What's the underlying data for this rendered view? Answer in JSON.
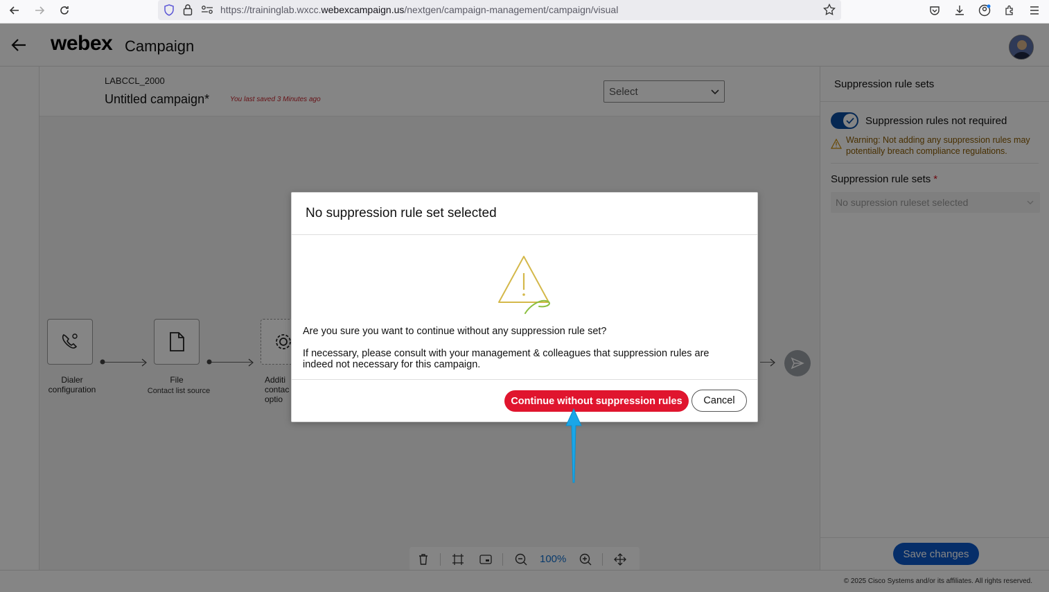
{
  "browser": {
    "url_prefix": "https://traininglab.wxcc.",
    "url_domain": "webexcampaign.us",
    "url_path": "/nextgen/campaign-management/campaign/visual"
  },
  "header": {
    "brand": "webex",
    "product": "Campaign"
  },
  "campaign": {
    "id": "LABCCL_2000",
    "name": "Untitled campaign*",
    "saved_note": "You last saved 3 Minutes ago",
    "select_placeholder": "Select"
  },
  "flow": {
    "nodes": [
      {
        "label": "Dialer",
        "label2": "configuration",
        "sub": ""
      },
      {
        "label": "File",
        "label2": "",
        "sub": "Contact list source"
      },
      {
        "label": "Additi",
        "label2": "contac",
        "label3": "optio"
      }
    ]
  },
  "toolbar": {
    "zoom": "100%"
  },
  "right_panel": {
    "title": "Suppression rule sets",
    "toggle_label": "Suppression rules not required",
    "toggle_on": true,
    "warning": "Warning: Not adding any suppression rules may potentially breach compliance regulations.",
    "field_label": "Suppression rule sets",
    "required_mark": "*",
    "field_placeholder": "No supression ruleset selected",
    "save_label": "Save changes"
  },
  "footer": {
    "copyright": "© 2025 Cisco Systems and/or its affiliates. All rights reserved."
  },
  "modal": {
    "title": "No suppression rule set selected",
    "question": "Are you sure you want to continue without any suppression rule set?",
    "body": "If necessary, please consult with your management & colleagues that suppression rules are indeed not necessary for this campaign.",
    "continue_label": "Continue without suppression rules",
    "cancel_label": "Cancel"
  },
  "colors": {
    "accent_blue": "#0d59c9",
    "danger_red": "#e0152e",
    "warning_brown": "#8a5a00",
    "pointer_cyan": "#1aa6e8"
  }
}
